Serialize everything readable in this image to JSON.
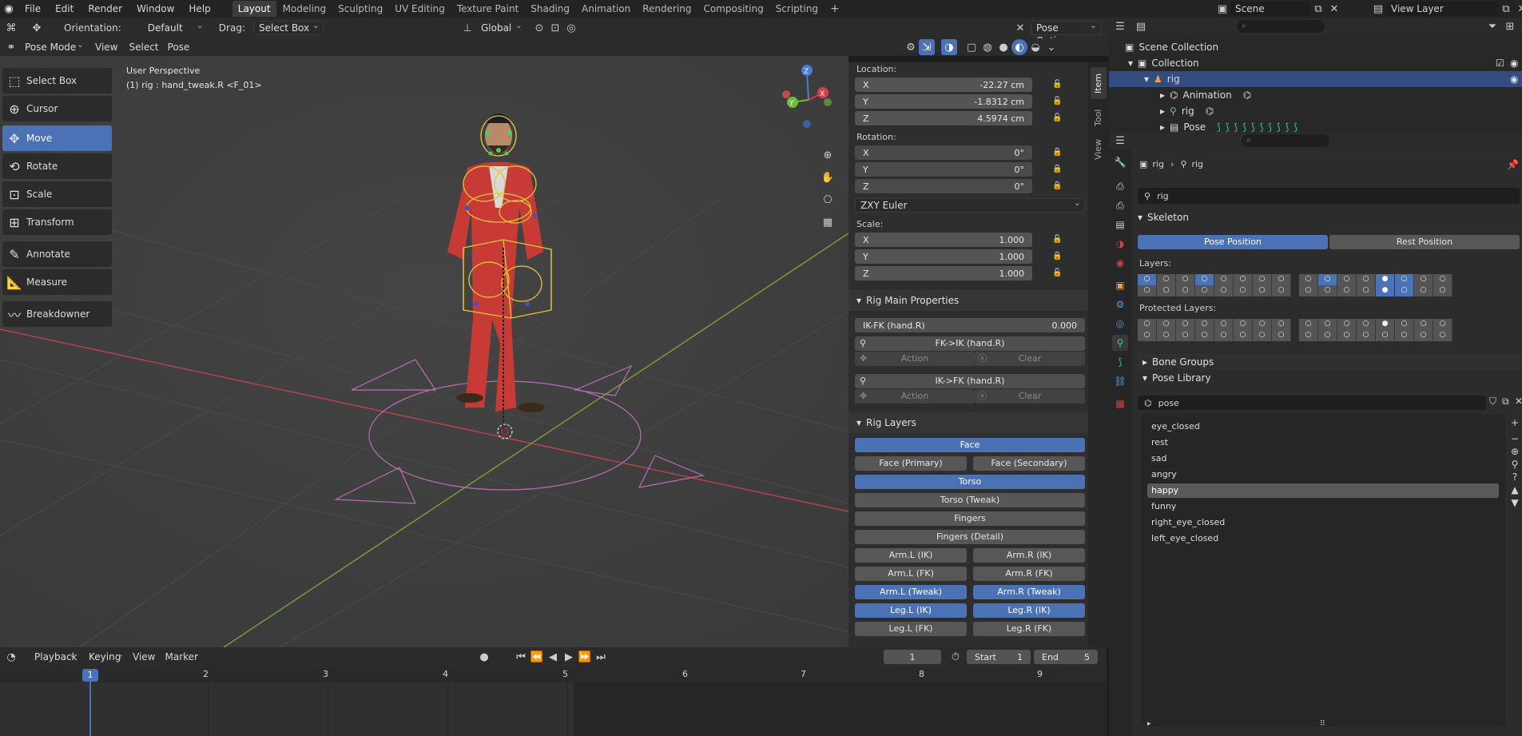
{
  "menu": {
    "file": "File",
    "edit": "Edit",
    "render": "Render",
    "window": "Window",
    "help": "Help"
  },
  "workspaces": [
    "Layout",
    "Modeling",
    "Sculpting",
    "UV Editing",
    "Texture Paint",
    "Shading",
    "Animation",
    "Rendering",
    "Compositing",
    "Scripting"
  ],
  "scene": "Scene",
  "view_layer": "View Layer",
  "tool_header": {
    "orientation_label": "Orientation:",
    "orientation_value": "Default",
    "drag_label": "Drag:",
    "drag_value": "Select Box",
    "transform_space": "Global",
    "pose_options": "Pose Options"
  },
  "viewport_header": {
    "mode": "Pose Mode",
    "view": "View",
    "select": "Select",
    "pose": "Pose"
  },
  "viewport": {
    "perspective": "User Perspective",
    "object_info": "(1) rig : hand_tweak.R <F_01>"
  },
  "gizmo_axes": {
    "x": "X",
    "y": "Y",
    "z": "Z"
  },
  "tools": [
    "Select Box",
    "Cursor",
    "Move",
    "Rotate",
    "Scale",
    "Transform",
    "Annotate",
    "Measure",
    "Breakdowner"
  ],
  "sidebar_tabs": [
    "Item",
    "Tool",
    "View"
  ],
  "transform": {
    "location_label": "Location:",
    "location": [
      {
        "axis": "X",
        "value": "-22.27 cm"
      },
      {
        "axis": "Y",
        "value": "-1.8312 cm"
      },
      {
        "axis": "Z",
        "value": "4.5974 cm"
      }
    ],
    "rotation_label": "Rotation:",
    "rotation": [
      {
        "axis": "X",
        "value": "0°"
      },
      {
        "axis": "Y",
        "value": "0°"
      },
      {
        "axis": "Z",
        "value": "0°"
      }
    ],
    "rotation_mode": "ZXY Euler",
    "scale_label": "Scale:",
    "scale": [
      {
        "axis": "X",
        "value": "1.000"
      },
      {
        "axis": "Y",
        "value": "1.000"
      },
      {
        "axis": "Z",
        "value": "1.000"
      }
    ]
  },
  "rig_main": {
    "title": "Rig Main Properties",
    "ikfk_label": "IK-FK (hand.R)",
    "ikfk_value": "0.000",
    "fk_ik_button": "FK->IK (hand.R)",
    "ik_fk_button": "IK->FK (hand.R)",
    "action": "Action",
    "clear": "Clear"
  },
  "rig_layers": {
    "title": "Rig Layers",
    "buttons": [
      {
        "label": "Face",
        "on": true
      },
      {
        "label": "Face (Primary)",
        "on": false
      },
      {
        "label": "Face (Secondary)",
        "on": false
      },
      {
        "label": "Torso",
        "on": true
      },
      {
        "label": "Torso (Tweak)",
        "on": false
      },
      {
        "label": "Fingers",
        "on": false
      },
      {
        "label": "Fingers (Detail)",
        "on": false
      },
      {
        "label": "Arm.L (IK)",
        "on": false
      },
      {
        "label": "Arm.R (IK)",
        "on": false
      },
      {
        "label": "Arm.L (FK)",
        "on": false
      },
      {
        "label": "Arm.R (FK)",
        "on": false
      },
      {
        "label": "Arm.L (Tweak)",
        "on": true
      },
      {
        "label": "Arm.R (Tweak)",
        "on": true
      },
      {
        "label": "Leg.L (IK)",
        "on": true
      },
      {
        "label": "Leg.R (IK)",
        "on": true
      },
      {
        "label": "Leg.L (FK)",
        "on": false
      },
      {
        "label": "Leg.R (FK)",
        "on": false
      }
    ]
  },
  "timeline": {
    "playback": "Playback",
    "keying": "Keying",
    "view": "View",
    "marker": "Marker",
    "current_frame": "1",
    "start_label": "Start",
    "start": "1",
    "end_label": "End",
    "end": "5",
    "frames": [
      "1",
      "2",
      "3",
      "4",
      "5",
      "6",
      "7",
      "8",
      "9"
    ]
  },
  "outliner": {
    "scene_collection": "Scene Collection",
    "collection": "Collection",
    "rig": "rig",
    "animation": "Animation",
    "rig_data": "rig",
    "pose": "Pose"
  },
  "properties": {
    "breadcrumb_object": "rig",
    "breadcrumb_data": "rig",
    "data_name": "rig",
    "skeleton": "Skeleton",
    "pose_position": "Pose Position",
    "rest_position": "Rest Position",
    "layers_label": "Layers:",
    "protected_label": "Protected Layers:",
    "bone_groups": "Bone Groups",
    "pose_library": "Pose Library",
    "pose_lib_name": "pose",
    "poses": [
      "eye_closed",
      "rest",
      "sad",
      "angry",
      "happy",
      "funny",
      "right_eye_closed",
      "left_eye_closed"
    ],
    "active_pose": "happy"
  },
  "colors": {
    "accent": "#4a72b5",
    "rig_wire": "#e6c53a",
    "character": "#c83a35"
  }
}
